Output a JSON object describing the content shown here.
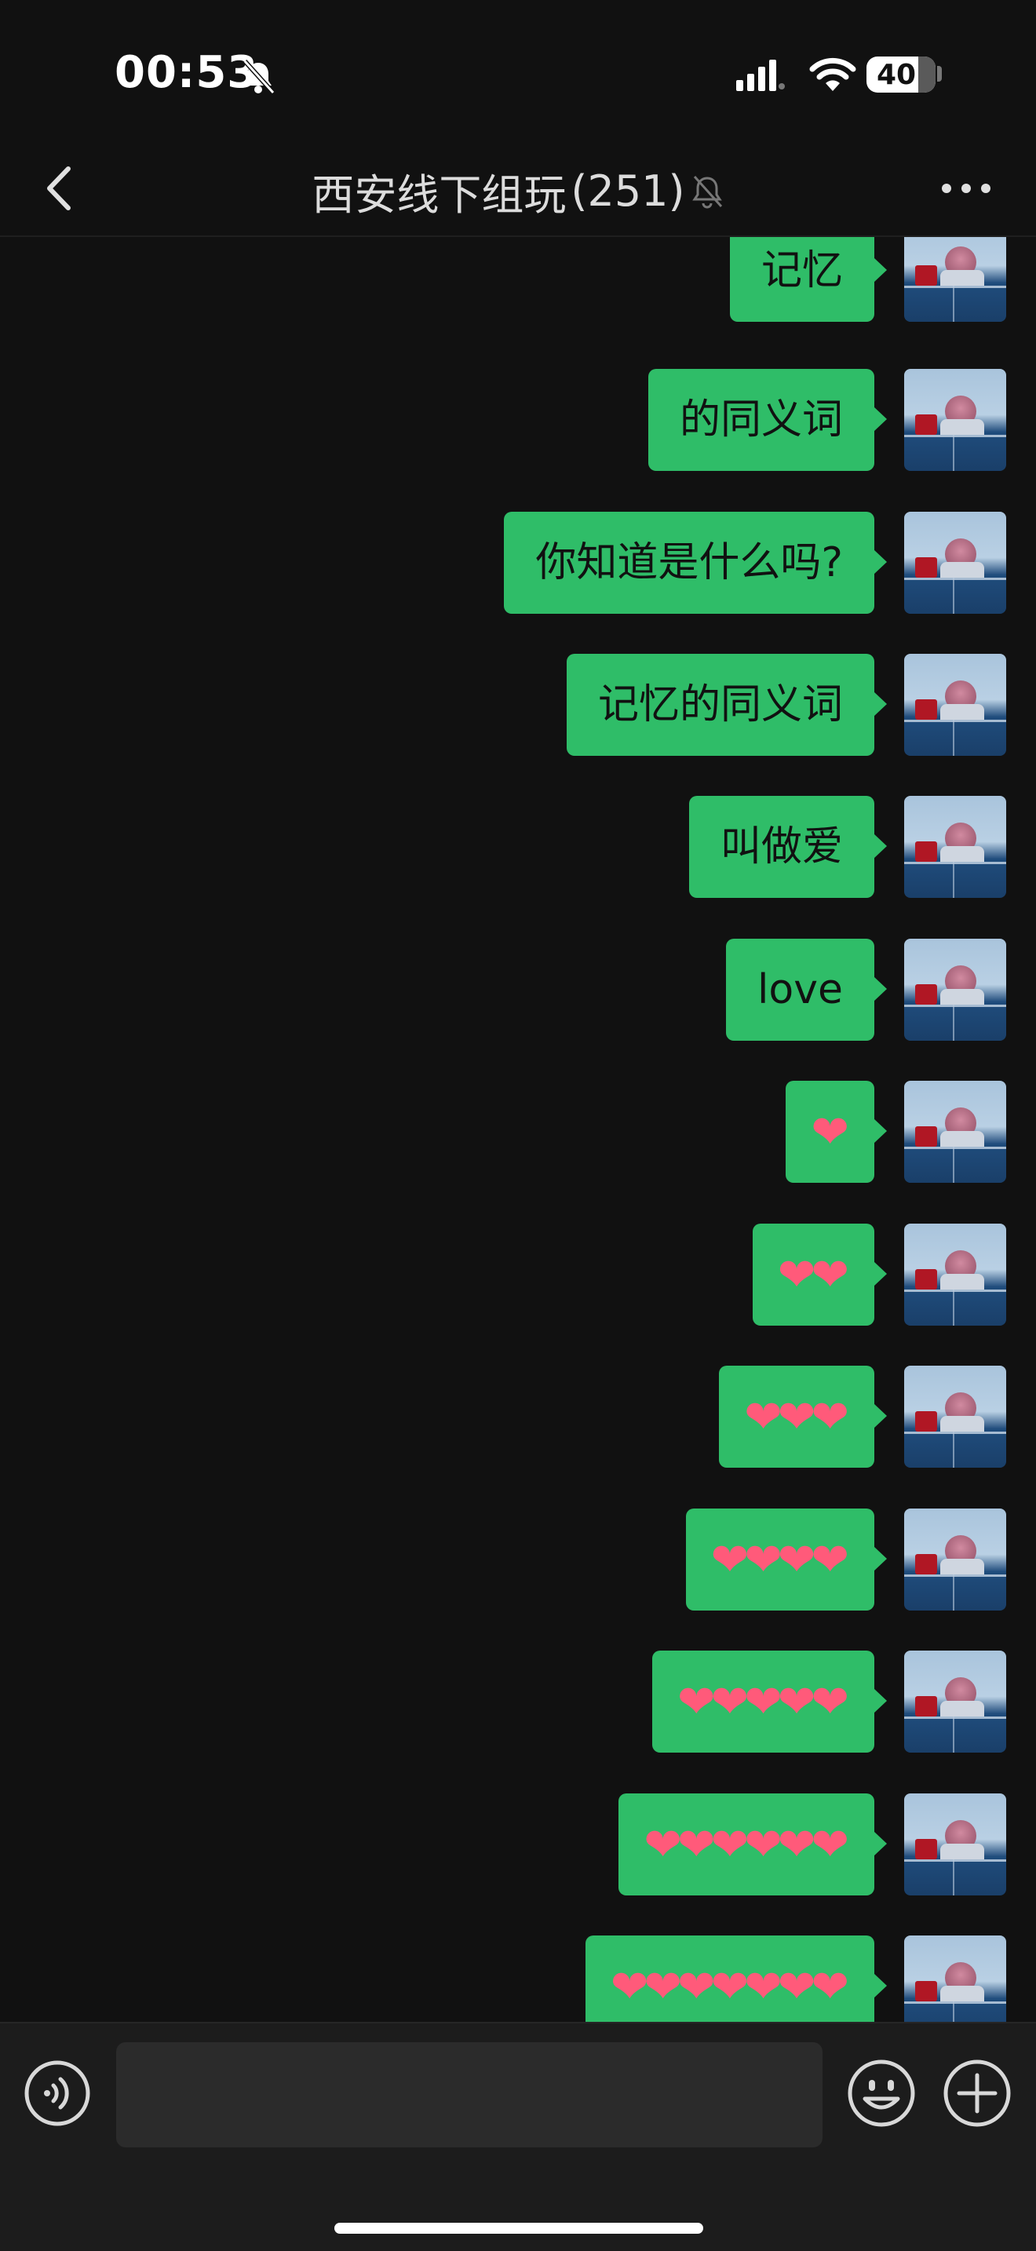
{
  "status_bar": {
    "time": "00:53",
    "battery": "40",
    "icons": [
      "bell-off-icon",
      "cellular-signal-icon",
      "wifi-icon",
      "battery-icon"
    ]
  },
  "nav": {
    "title": "西安线下组玩",
    "member_count": "(251)",
    "icons": [
      "back-chevron-icon",
      "muted-bell-icon",
      "more-dots-icon"
    ]
  },
  "messages": [
    {
      "text": "记忆",
      "type": "text"
    },
    {
      "text": "的同义词",
      "type": "text"
    },
    {
      "text": "你知道是什么吗?",
      "type": "text"
    },
    {
      "text": "记忆的同义词",
      "type": "text"
    },
    {
      "text": "叫做爱",
      "type": "text"
    },
    {
      "text": "love",
      "type": "text"
    },
    {
      "text": "❤",
      "type": "hearts"
    },
    {
      "text": "❤❤",
      "type": "hearts"
    },
    {
      "text": "❤❤❤",
      "type": "hearts"
    },
    {
      "text": "❤❤❤❤",
      "type": "hearts"
    },
    {
      "text": "❤❤❤❤❤",
      "type": "hearts"
    },
    {
      "text": "❤❤❤❤❤❤",
      "type": "hearts"
    },
    {
      "text": "❤❤❤❤❤❤❤",
      "type": "hearts"
    }
  ],
  "input": {
    "placeholder": "",
    "icons": [
      "voice-icon",
      "emoji-icon",
      "plus-icon"
    ]
  },
  "colors": {
    "background": "#111111",
    "bubble_self": "#2fbd68",
    "heart": "#ff5a7a",
    "input_bar": "#1c1c1c"
  }
}
